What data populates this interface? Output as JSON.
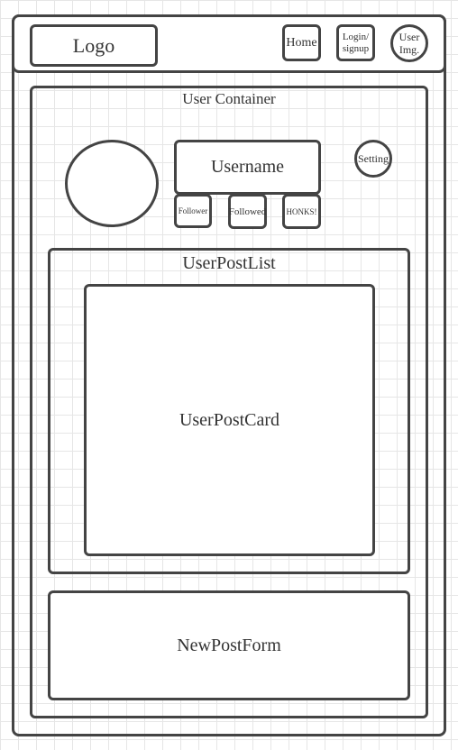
{
  "header": {
    "logo": "Logo",
    "home": "Home",
    "login_signup_line1": "Login/",
    "login_signup_line2": "signup",
    "user_img_line1": "User",
    "user_img_line2": "Img."
  },
  "user_container": {
    "title": "User Container",
    "username": "Username",
    "setting": "Setting",
    "follower": "Follower",
    "followed": "Followed",
    "honks": "HONKS!"
  },
  "user_post_list": {
    "title": "UserPostList",
    "card": "UserPostCard"
  },
  "new_post_form": {
    "title": "NewPostForm"
  }
}
